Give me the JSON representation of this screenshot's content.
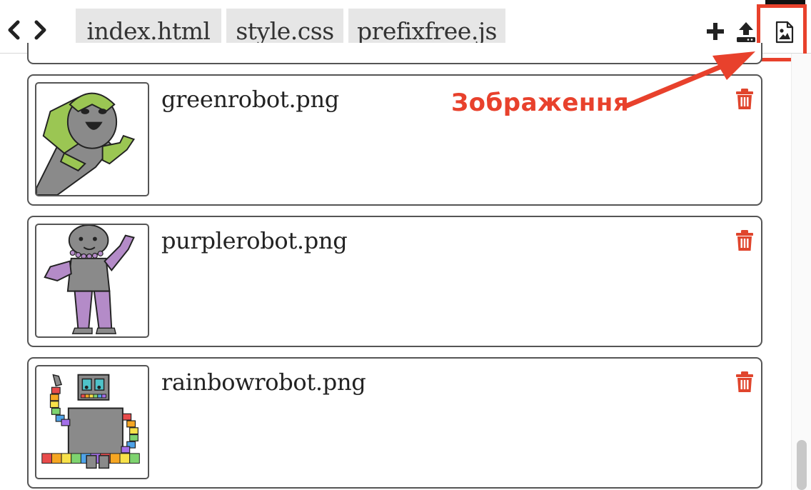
{
  "tabs": [
    {
      "label": "index.html"
    },
    {
      "label": "style.css"
    },
    {
      "label": "prefixfree.js"
    }
  ],
  "toolbar": {
    "back_icon": "chevron-left-icon",
    "forward_icon": "chevron-right-icon",
    "add_icon": "plus-icon",
    "upload_icon": "upload-icon",
    "images_icon": "image-file-icon"
  },
  "images": [
    {
      "filename": "greenrobot.png",
      "accent": "#9bc653"
    },
    {
      "filename": "purplerobot.png",
      "accent": "#b48bc8"
    },
    {
      "filename": "rainbowrobot.png",
      "accent": "#4fc3c9"
    }
  ],
  "annotation": {
    "label": "Зображення",
    "color": "#e8412c"
  },
  "colors": {
    "delete": "#e0452d",
    "tab_bg": "#e6e6e6"
  }
}
